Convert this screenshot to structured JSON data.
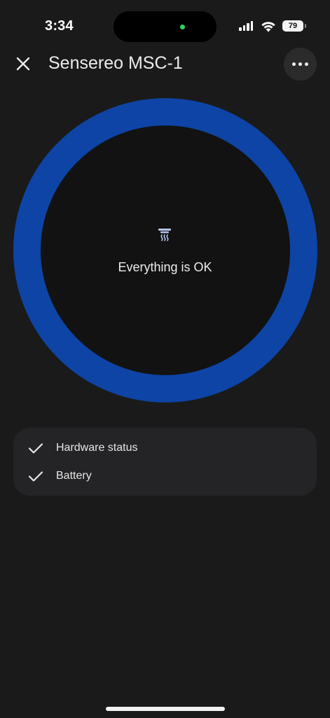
{
  "status_bar": {
    "time": "3:34",
    "battery_level": "79",
    "icons": [
      "cellular-signal-icon",
      "wifi-icon",
      "battery-icon"
    ]
  },
  "header": {
    "title": "Sensereo MSC-1",
    "close_icon": "close-icon",
    "more_icon": "more-horizontal-icon"
  },
  "device_status": {
    "icon": "smoke-detector-icon",
    "message": "Everything is OK",
    "ring_color": "#0d44a5"
  },
  "checks": [
    {
      "label": "Hardware status",
      "icon": "check-icon",
      "state": "ok"
    },
    {
      "label": "Battery",
      "icon": "check-icon",
      "state": "ok"
    }
  ],
  "colors": {
    "background": "#1a1a1b",
    "card": "#242426",
    "accent": "#0d44a5",
    "icon_tint": "#b7c6f0"
  }
}
